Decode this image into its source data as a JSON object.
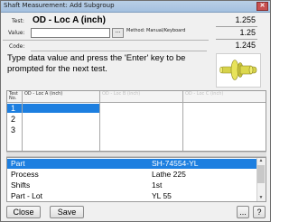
{
  "window": {
    "title": "Shaft Measurement: Add Subgroup"
  },
  "form": {
    "test_label": "Test:",
    "test_name": "OD - Loc A (inch)",
    "value_label": "Value:",
    "value": "",
    "browse_label": "...",
    "method_text": "Method: Manual/Keyboard",
    "code_label": "Code:",
    "code": ""
  },
  "spec": {
    "upper": "1.255",
    "target": "1.25",
    "lower": "1.245"
  },
  "instruction": "Type data value and press the 'Enter' key to be prompted for the next test.",
  "grid": {
    "headers": [
      "Test No.",
      "OD - Loc A (inch)",
      "OD - Loc B (inch)",
      "OD - Loc C (inch)"
    ],
    "rows": [
      "1",
      "2",
      "3"
    ]
  },
  "info": {
    "rows": [
      {
        "key": "Part",
        "value": "SH-74554-YL"
      },
      {
        "key": "Process",
        "value": "Lathe 225"
      },
      {
        "key": "Shifts",
        "value": "1st"
      },
      {
        "key": "Part - Lot",
        "value": "YL 55"
      }
    ]
  },
  "buttons": {
    "close": "Close",
    "save": "Save",
    "options": "...",
    "help": "?"
  }
}
